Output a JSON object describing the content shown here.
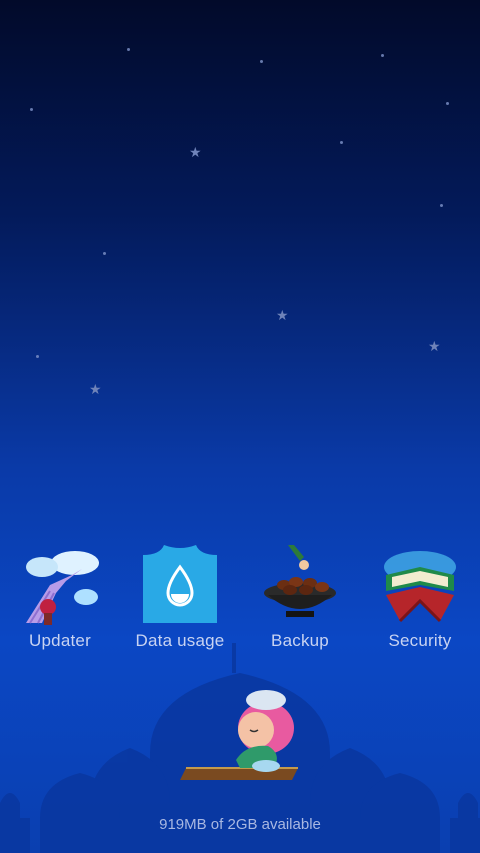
{
  "apps": [
    {
      "label": "Updater",
      "icon": "stairway-to-heaven-icon"
    },
    {
      "label": "Data usage",
      "icon": "water-drop-icon"
    },
    {
      "label": "Backup",
      "icon": "dates-bowl-icon"
    },
    {
      "label": "Security",
      "icon": "quran-stand-icon"
    }
  ],
  "storage": {
    "text": "919MB of 2GB available"
  },
  "colors": {
    "data_usage_tile": "#29a9e6",
    "background_top": "#020a2a",
    "background_bottom": "#0b47c4"
  }
}
